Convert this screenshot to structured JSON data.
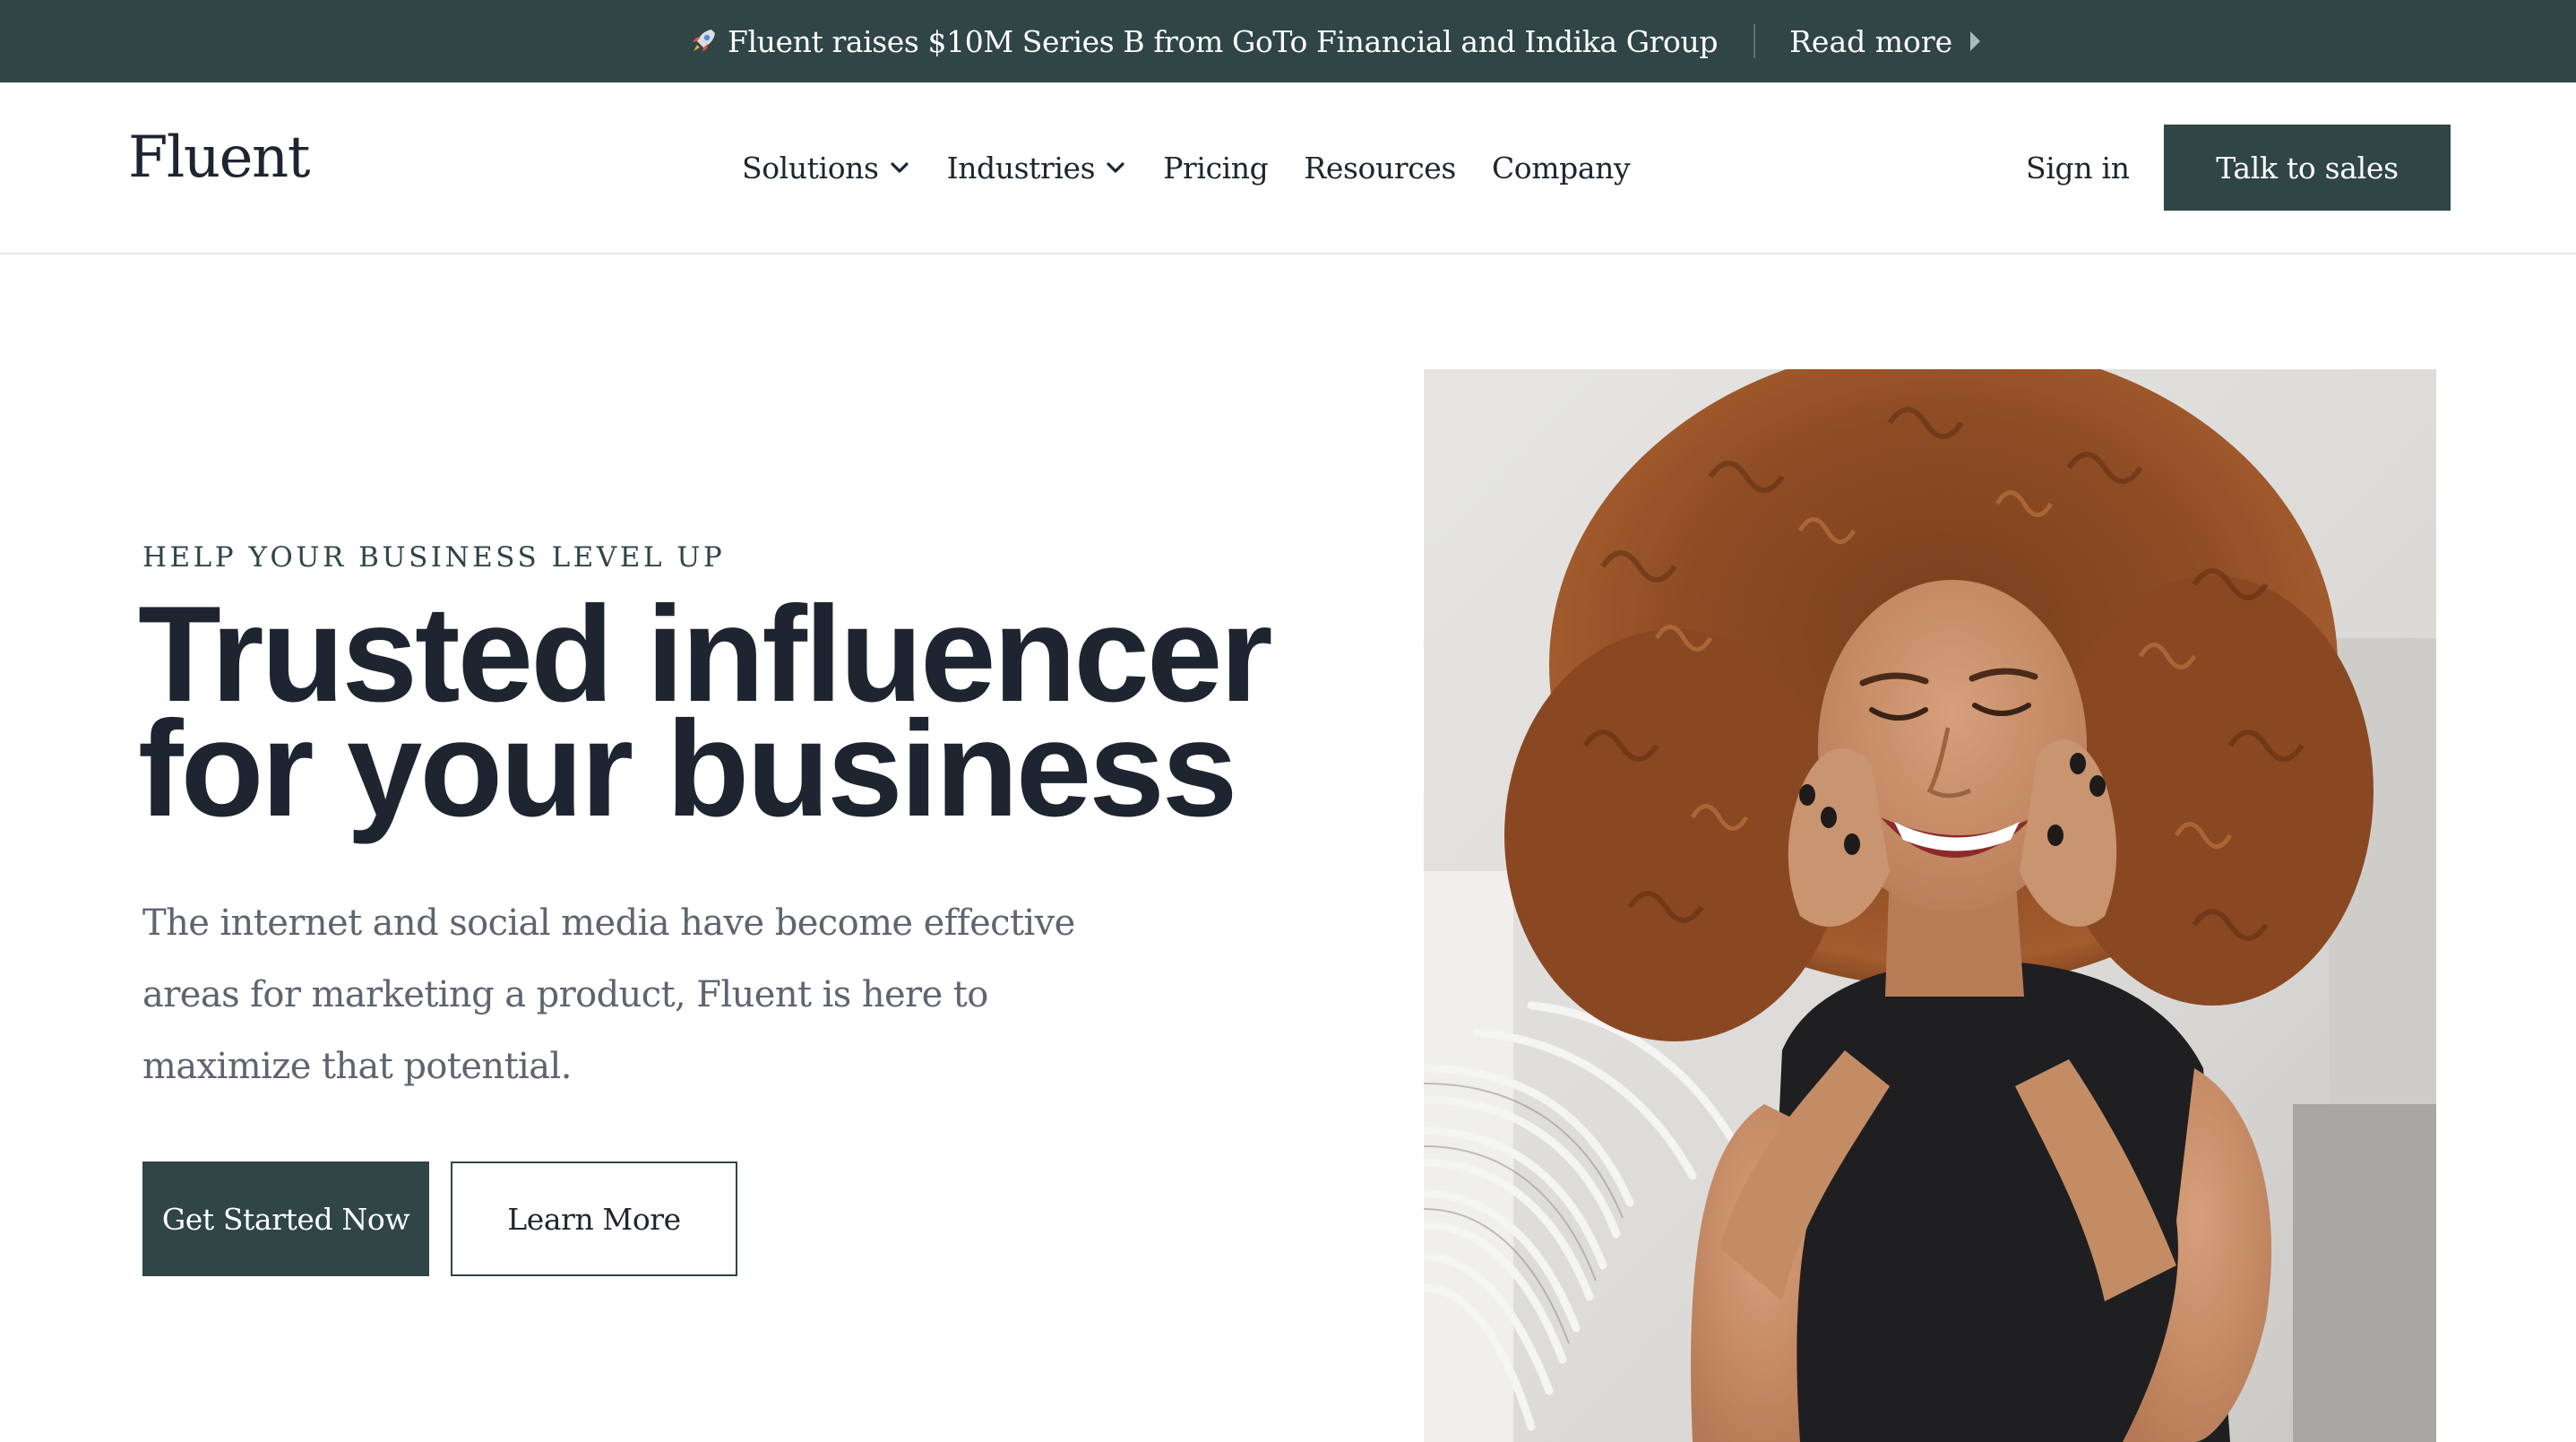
{
  "announcement": {
    "icon": "rocket-icon",
    "text": "Fluent raises $10M Series B from GoTo Financial and Indika Group",
    "link_label": "Read more"
  },
  "header": {
    "logo": "Fluent",
    "nav": [
      {
        "label": "Solutions",
        "has_dropdown": true
      },
      {
        "label": "Industries",
        "has_dropdown": true
      },
      {
        "label": "Pricing",
        "has_dropdown": false
      },
      {
        "label": "Resources",
        "has_dropdown": false
      },
      {
        "label": "Company",
        "has_dropdown": false
      }
    ],
    "sign_in": "Sign in",
    "cta": "Talk to sales"
  },
  "hero": {
    "eyebrow": "HELP YOUR BUSINESS LEVEL UP",
    "headline": [
      "Trusted influencer",
      "for your business"
    ],
    "description": [
      "The internet and social media have become effective",
      "areas for marketing a product, Fluent is here to",
      "maximize that potential."
    ],
    "primary_button": "Get Started Now",
    "secondary_button": "Learn More"
  },
  "colors": {
    "brand_dark": "#2f4546",
    "text_dark": "#1f2530",
    "text_muted": "#5f6470",
    "border": "#e5e7ea"
  }
}
